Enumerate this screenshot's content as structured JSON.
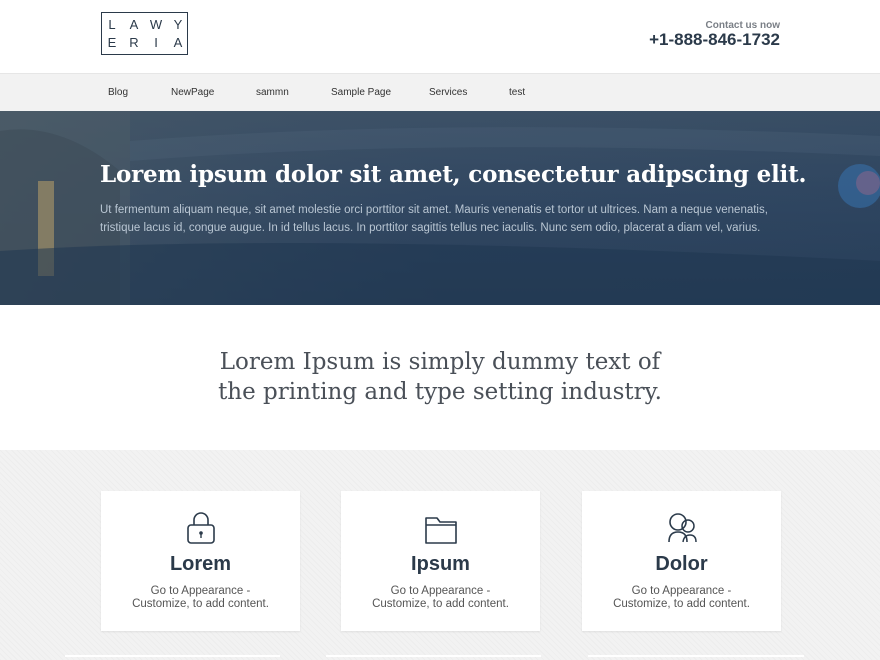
{
  "header": {
    "logo_letters_row1": [
      "L",
      "A",
      "W",
      "Y"
    ],
    "logo_letters_row2": [
      "E",
      "R",
      "I",
      "A"
    ],
    "contact_label": "Contact us now",
    "phone": "+1-888-846-1732"
  },
  "nav": {
    "items": [
      {
        "label": "Blog"
      },
      {
        "label": "NewPage"
      },
      {
        "label": "sammn"
      },
      {
        "label": "Sample Page"
      },
      {
        "label": "Services"
      },
      {
        "label": "test"
      }
    ]
  },
  "hero": {
    "title": "Lorem ipsum dolor sit amet, consectetur adipscing elit.",
    "text": "Ut fermentum aliquam neque, sit amet molestie orci porttitor sit amet. Mauris venenatis et tortor ut ultrices. Nam a neque venenatis, tristique lacus id, congue augue. In id tellus lacus. In porttitor sagittis tellus nec iaculis. Nunc sem odio, placerat a diam vel, varius."
  },
  "tagline": {
    "line1": "Lorem Ipsum is simply dummy text of",
    "line2": "the printing and type setting industry."
  },
  "features": {
    "cards": [
      {
        "icon": "lock-icon",
        "title": "Lorem",
        "text_line1": "Go to Appearance -",
        "text_line2": "Customize, to add content."
      },
      {
        "icon": "folder-icon",
        "title": "Ipsum",
        "text_line1": "Go to Appearance -",
        "text_line2": "Customize, to add content."
      },
      {
        "icon": "users-icon",
        "title": "Dolor",
        "text_line1": "Go to Appearance -",
        "text_line2": "Customize, to add content."
      }
    ]
  },
  "colors": {
    "brand_dark": "#2b3a4a",
    "hero_overlay": "#2f4560",
    "nav_bg": "#f2f2f2"
  }
}
